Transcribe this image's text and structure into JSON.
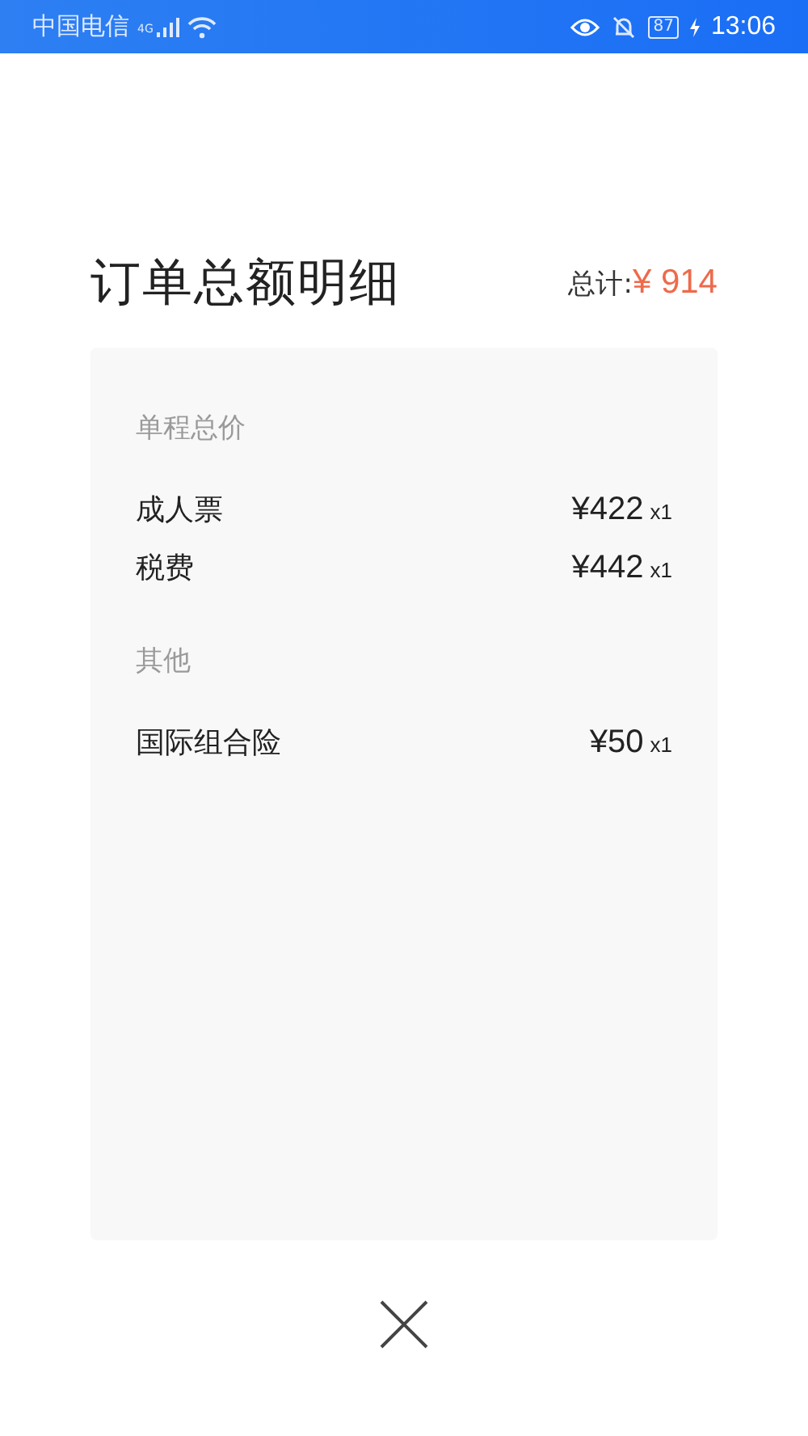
{
  "status_bar": {
    "carrier": "中国电信",
    "network": "4G",
    "battery": "87",
    "time": "13:06"
  },
  "header": {
    "title": "订单总额明细",
    "total_label": "总计:",
    "total_value": "¥ 914"
  },
  "sections": [
    {
      "title": "单程总价",
      "items": [
        {
          "name": "成人票",
          "price": "¥422",
          "quantity": "x1"
        },
        {
          "name": "税费",
          "price": "¥442",
          "quantity": "x1"
        }
      ]
    },
    {
      "title": "其他",
      "items": [
        {
          "name": "国际组合险",
          "price": "¥50",
          "quantity": "x1"
        }
      ]
    }
  ]
}
